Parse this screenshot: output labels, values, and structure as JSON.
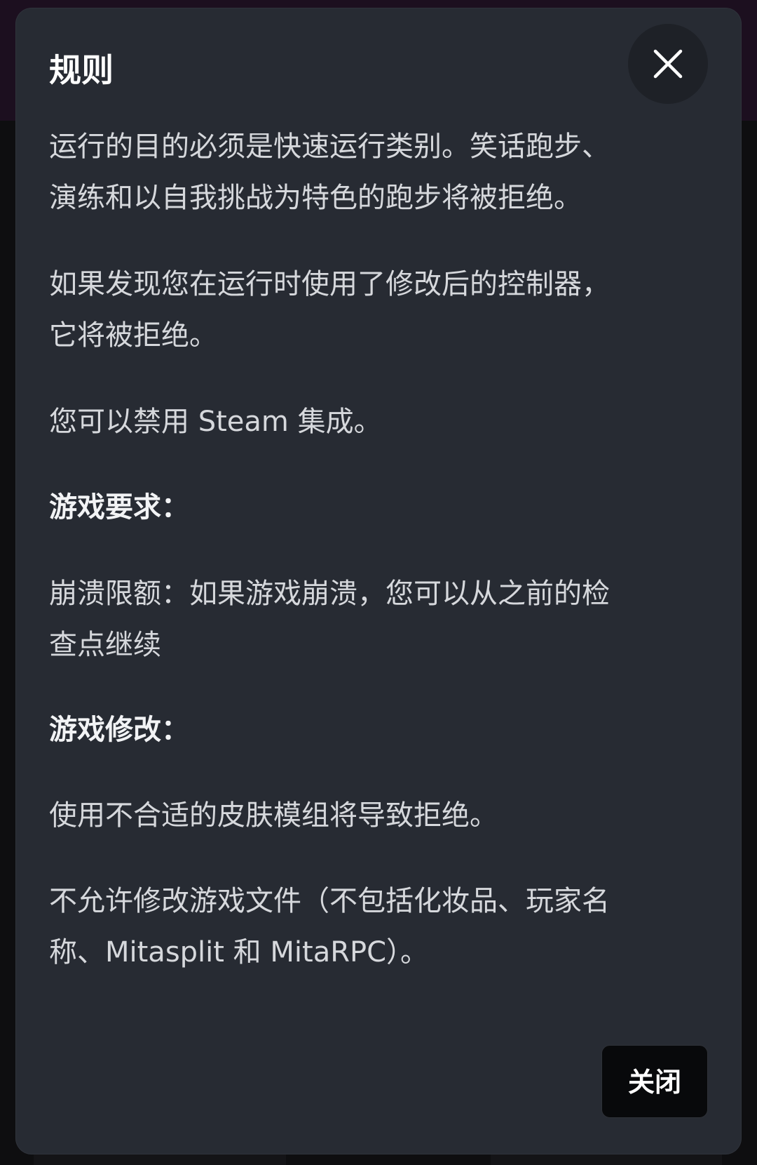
{
  "modal": {
    "title": "规则",
    "close_icon": "close-icon",
    "paragraphs": {
      "p1_line1": "运行的目的必须是快速运行类别。笑话跑步、",
      "p1_line2": "演练和以自我挑战为特色的跑步将被拒绝。",
      "p2_line1": "如果发现您在运行时使用了修改后的控制器，",
      "p2_line2": "它将被拒绝。",
      "p3": "您可以禁用 Steam 集成。",
      "heading1": "游戏要求：",
      "p4_line1": "崩溃限额：如果游戏崩溃，您可以从之前的检",
      "p4_line2": "查点继续",
      "heading2": "游戏修改：",
      "p5": "使用不合适的皮肤模组将导致拒绝。",
      "p6_line1": "不允许修改游戏文件（不包括化妆品、玩家名",
      "p6_line2": "称、Mitasplit 和 MitaRPC）。"
    },
    "close_button_label": "关闭"
  },
  "colors": {
    "modal_background": "#272b33",
    "title_text": "#ffffff",
    "body_text": "#d6d8dc",
    "button_background": "#08090b"
  }
}
